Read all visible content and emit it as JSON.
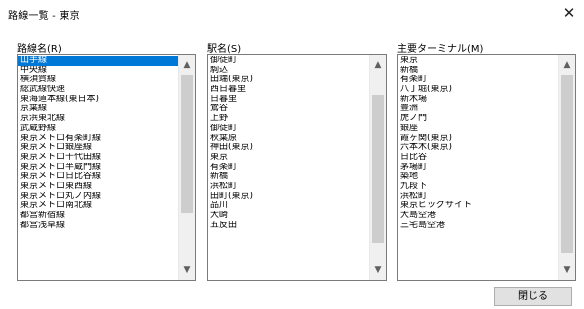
{
  "window": {
    "title": "路線一覧 - 東京",
    "close_glyph": "✕"
  },
  "columns": [
    {
      "label": "路線名(R)",
      "selected_index": 0,
      "items": [
        "山手線",
        "中央線",
        "横須賀線",
        "総武線快速",
        "東海道本線(東日本)",
        "京葉線",
        "京浜東北線",
        "武蔵野線",
        "東京メトロ有楽町線",
        "東京メトロ銀座線",
        "東京メトロ千代田線",
        "東京メトロ半蔵門線",
        "東京メトロ日比谷線",
        "東京メトロ東西線",
        "東京メトロ丸ノ内線",
        "東京メトロ南北線",
        "都営新宿線",
        "都営浅草線"
      ]
    },
    {
      "label": "駅名(S)",
      "selected_index": -1,
      "items": [
        "御徒町",
        "駒込",
        "田端(東京)",
        "西日暮里",
        "日暮里",
        "鶯谷",
        "上野",
        "御徒町",
        "秋葉原",
        "神田(東京)",
        "東京",
        "有楽町",
        "新橋",
        "浜松町",
        "田町(東京)",
        "品川",
        "大崎",
        "五反田"
      ]
    },
    {
      "label": "主要ターミナル(M)",
      "selected_index": -1,
      "items": [
        "東京",
        "新橋",
        "有楽町",
        "八丁堀(東京)",
        "新木場",
        "豊洲",
        "虎ノ門",
        "銀座",
        "霞ヶ関(東京)",
        "六本木(東京)",
        "日比谷",
        "茅場町",
        "築地",
        "九段下",
        "浜松町",
        "東京ビッグサイト",
        "大島空港",
        "三宅島空港"
      ]
    }
  ],
  "scroll": {
    "up_glyph": "▲",
    "down_glyph": "▼"
  },
  "buttons": {
    "close_label": "閉じる"
  }
}
